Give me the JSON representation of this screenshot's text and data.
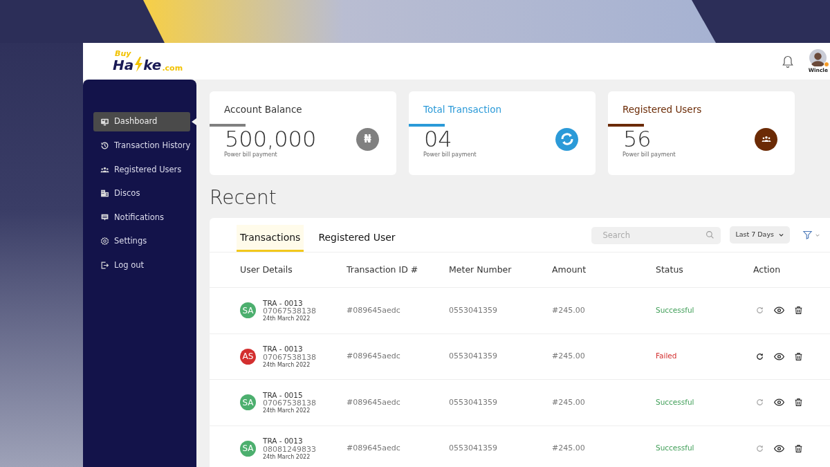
{
  "logo": {
    "tagline": "Buy",
    "left": "Ha",
    "right": "ke",
    "domain": ".com"
  },
  "header": {
    "user_name": "Wincle",
    "online": true
  },
  "sidebar": {
    "items": [
      {
        "label": "Dashboard",
        "selected": true
      },
      {
        "label": "Transaction History",
        "selected": false
      },
      {
        "label": "Registered Users",
        "selected": false
      },
      {
        "label": "Discos",
        "selected": false
      },
      {
        "label": "Notifications",
        "selected": false
      },
      {
        "label": "Settings",
        "selected": false
      },
      {
        "label": "Log out",
        "selected": false
      }
    ]
  },
  "stats": [
    {
      "title": "Account Balance",
      "value": "500,000",
      "caption": "Power bill payment",
      "color": "#808080",
      "symbol": "₦"
    },
    {
      "title": "Total Transaction",
      "value": "04",
      "caption": "Power bill payment",
      "color": "#2b9ad8"
    },
    {
      "title": "Registered Users",
      "value": "56",
      "caption": "Power bill payment",
      "color": "#6b2a05"
    }
  ],
  "section_title": "Recent",
  "tabs": [
    {
      "label": "Transactions",
      "selected": true
    },
    {
      "label": "Registered User",
      "selected": false
    }
  ],
  "search": {
    "placeholder": "Search"
  },
  "period": "Last 7 Days",
  "table": {
    "columns": [
      "User Details",
      "Transaction ID #",
      "Meter Number",
      "Amount",
      "Status",
      "Action"
    ],
    "rows": [
      {
        "initials": "SA",
        "color": "#4caf6e",
        "id": "TRA - 0013",
        "phone": "07067538138",
        "date": "24th March 2022",
        "txn": "#089645aedc",
        "meter": "0553041359",
        "amount": "#245.00",
        "status": "Successful",
        "kind": "success",
        "retry_enabled": false
      },
      {
        "initials": "AS",
        "color": "#d32f2f",
        "id": "TRA - 0013",
        "phone": "07067538138",
        "date": "24th March 2022",
        "txn": "#089645aedc",
        "meter": "0553041359",
        "amount": "#245.00",
        "status": "Failed",
        "kind": "failed",
        "retry_enabled": true
      },
      {
        "initials": "SA",
        "color": "#4caf6e",
        "id": "TRA - 0015",
        "phone": "07067538138",
        "date": "24th March 2022",
        "txn": "#089645aedc",
        "meter": "0553041359",
        "amount": "#245.00",
        "status": "Successful",
        "kind": "success",
        "retry_enabled": false
      },
      {
        "initials": "SA",
        "color": "#4caf6e",
        "id": "TRA - 0013",
        "phone": "08081249833",
        "date": "24th March 2022",
        "txn": "#089645aedc",
        "meter": "0553041359",
        "amount": "#245.00",
        "status": "Successful",
        "kind": "success",
        "retry_enabled": false
      }
    ]
  }
}
